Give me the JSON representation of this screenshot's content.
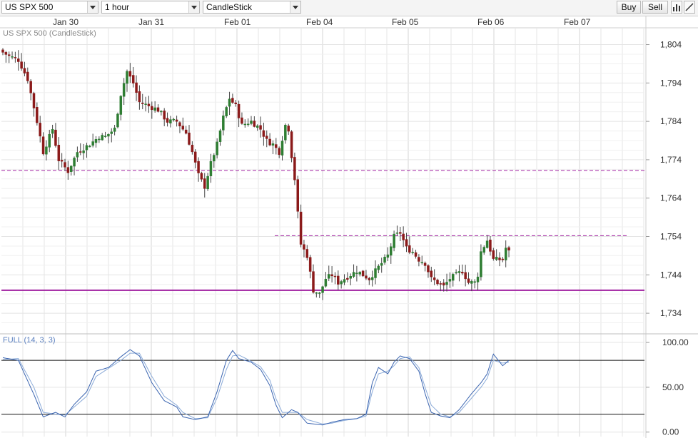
{
  "toolbar": {
    "symbol": "US SPX 500",
    "interval": "1 hour",
    "chart_type": "CandleStick",
    "buy_label": "Buy",
    "sell_label": "Sell",
    "icons": [
      "bar-chart-icon",
      "draw-line-icon"
    ]
  },
  "colors": {
    "bull": "#2e7d32",
    "bear": "#8b1a1a",
    "support_line": "#a020a0",
    "resistance_line": "#a020a0",
    "stoch_k": "#3a64b0",
    "stoch_d": "#8aaad8",
    "grid": "#e4e4e4"
  },
  "chart_data": [
    {
      "type": "candlestick",
      "title": "US SPX 500 (CandleStick)",
      "x_tick_labels": [
        "Jan 30",
        "Jan 31",
        "Feb 01",
        "Feb 04",
        "Feb 05",
        "Feb 06",
        "Feb 07"
      ],
      "y_ticks": [
        "1,804",
        "1,794",
        "1,784",
        "1,774",
        "1,764",
        "1,754",
        "1,744",
        "1,734"
      ],
      "ylim": [
        1729,
        1808
      ],
      "grid": true,
      "levels": [
        {
          "name": "resistance-upper",
          "value": 1771.2,
          "style": "dashed"
        },
        {
          "name": "resistance-lower",
          "value": 1754.2,
          "style": "dashed"
        },
        {
          "name": "support",
          "value": 1740.0,
          "style": "solid"
        }
      ],
      "anchors": [
        {
          "i": 0,
          "v": 1802
        },
        {
          "i": 2,
          "v": 1801
        },
        {
          "i": 5,
          "v": 1800
        },
        {
          "i": 8,
          "v": 1795
        },
        {
          "i": 11,
          "v": 1784
        },
        {
          "i": 13,
          "v": 1776
        },
        {
          "i": 16,
          "v": 1782
        },
        {
          "i": 18,
          "v": 1774
        },
        {
          "i": 21,
          "v": 1771
        },
        {
          "i": 24,
          "v": 1776
        },
        {
          "i": 28,
          "v": 1778
        },
        {
          "i": 31,
          "v": 1780
        },
        {
          "i": 33,
          "v": 1780
        },
        {
          "i": 36,
          "v": 1782
        },
        {
          "i": 38,
          "v": 1791
        },
        {
          "i": 40,
          "v": 1797
        },
        {
          "i": 42,
          "v": 1794
        },
        {
          "i": 44,
          "v": 1789
        },
        {
          "i": 47,
          "v": 1788
        },
        {
          "i": 50,
          "v": 1787
        },
        {
          "i": 53,
          "v": 1784
        },
        {
          "i": 56,
          "v": 1784
        },
        {
          "i": 59,
          "v": 1781
        },
        {
          "i": 61,
          "v": 1776
        },
        {
          "i": 63,
          "v": 1770
        },
        {
          "i": 65,
          "v": 1767
        },
        {
          "i": 67,
          "v": 1773
        },
        {
          "i": 69,
          "v": 1778
        },
        {
          "i": 71,
          "v": 1785
        },
        {
          "i": 73,
          "v": 1790
        },
        {
          "i": 75,
          "v": 1788
        },
        {
          "i": 77,
          "v": 1783
        },
        {
          "i": 80,
          "v": 1784
        },
        {
          "i": 83,
          "v": 1782
        },
        {
          "i": 85,
          "v": 1779
        },
        {
          "i": 87,
          "v": 1778
        },
        {
          "i": 89,
          "v": 1776
        },
        {
          "i": 91,
          "v": 1783
        },
        {
          "i": 92,
          "v": 1782
        },
        {
          "i": 93,
          "v": 1775
        },
        {
          "i": 94,
          "v": 1769
        },
        {
          "i": 95,
          "v": 1760
        },
        {
          "i": 96,
          "v": 1752
        },
        {
          "i": 98,
          "v": 1749
        },
        {
          "i": 100,
          "v": 1740
        },
        {
          "i": 102,
          "v": 1739
        },
        {
          "i": 104,
          "v": 1743
        },
        {
          "i": 106,
          "v": 1744
        },
        {
          "i": 108,
          "v": 1742
        },
        {
          "i": 110,
          "v": 1743
        },
        {
          "i": 112,
          "v": 1744
        },
        {
          "i": 114,
          "v": 1745
        },
        {
          "i": 116,
          "v": 1744
        },
        {
          "i": 118,
          "v": 1743
        },
        {
          "i": 120,
          "v": 1745
        },
        {
          "i": 122,
          "v": 1747
        },
        {
          "i": 124,
          "v": 1749
        },
        {
          "i": 126,
          "v": 1754
        },
        {
          "i": 128,
          "v": 1755
        },
        {
          "i": 130,
          "v": 1751
        },
        {
          "i": 132,
          "v": 1750
        },
        {
          "i": 134,
          "v": 1748
        },
        {
          "i": 136,
          "v": 1747
        },
        {
          "i": 138,
          "v": 1743
        },
        {
          "i": 140,
          "v": 1742
        },
        {
          "i": 142,
          "v": 1741
        },
        {
          "i": 144,
          "v": 1743
        },
        {
          "i": 146,
          "v": 1744
        },
        {
          "i": 148,
          "v": 1745
        },
        {
          "i": 150,
          "v": 1742
        },
        {
          "i": 152,
          "v": 1742
        },
        {
          "i": 153,
          "v": 1744
        },
        {
          "i": 154,
          "v": 1750
        },
        {
          "i": 156,
          "v": 1753
        },
        {
          "i": 158,
          "v": 1748
        },
        {
          "i": 160,
          "v": 1748
        },
        {
          "i": 161,
          "v": 1748
        },
        {
          "i": 162,
          "v": 1751
        },
        {
          "i": 163,
          "v": 1750
        }
      ],
      "candle_count": 164,
      "last_close": 1750
    },
    {
      "type": "line",
      "title": "FULL (14, 3, 3)",
      "y_ticks": [
        "100.00",
        "50.00",
        "0.00"
      ],
      "ylim": [
        -5,
        108
      ],
      "levels": [
        80,
        20
      ],
      "series": [
        {
          "name": "%K",
          "anchors": [
            [
              0,
              83
            ],
            [
              5,
              80
            ],
            [
              10,
              42
            ],
            [
              13,
              17
            ],
            [
              17,
              22
            ],
            [
              20,
              17
            ],
            [
              23,
              31
            ],
            [
              27,
              45
            ],
            [
              30,
              68
            ],
            [
              34,
              72
            ],
            [
              38,
              84
            ],
            [
              41,
              92
            ],
            [
              44,
              85
            ],
            [
              48,
              55
            ],
            [
              52,
              35
            ],
            [
              56,
              28
            ],
            [
              58,
              17
            ],
            [
              62,
              14
            ],
            [
              66,
              17
            ],
            [
              69,
              45
            ],
            [
              72,
              80
            ],
            [
              74,
              91
            ],
            [
              76,
              82
            ],
            [
              80,
              78
            ],
            [
              83,
              70
            ],
            [
              86,
              52
            ],
            [
              88,
              30
            ],
            [
              90,
              16
            ],
            [
              93,
              25
            ],
            [
              95,
              22
            ],
            [
              98,
              10
            ],
            [
              103,
              8
            ],
            [
              106,
              11
            ],
            [
              110,
              14
            ],
            [
              114,
              15
            ],
            [
              117,
              20
            ],
            [
              119,
              55
            ],
            [
              121,
              72
            ],
            [
              124,
              65
            ],
            [
              126,
              78
            ],
            [
              128,
              85
            ],
            [
              131,
              82
            ],
            [
              134,
              68
            ],
            [
              136,
              43
            ],
            [
              138,
              22
            ],
            [
              141,
              18
            ],
            [
              144,
              16
            ],
            [
              147,
              25
            ],
            [
              151,
              43
            ],
            [
              154,
              55
            ],
            [
              156,
              65
            ],
            [
              158,
              87
            ],
            [
              161,
              74
            ],
            [
              163,
              80
            ]
          ]
        },
        {
          "name": "%D",
          "anchors": [
            [
              0,
              81
            ],
            [
              5,
              82
            ],
            [
              10,
              50
            ],
            [
              13,
              22
            ],
            [
              17,
              20
            ],
            [
              20,
              19
            ],
            [
              23,
              28
            ],
            [
              27,
              40
            ],
            [
              30,
              62
            ],
            [
              34,
              71
            ],
            [
              38,
              80
            ],
            [
              41,
              88
            ],
            [
              44,
              88
            ],
            [
              48,
              62
            ],
            [
              52,
              40
            ],
            [
              56,
              30
            ],
            [
              58,
              22
            ],
            [
              62,
              15
            ],
            [
              66,
              16
            ],
            [
              69,
              38
            ],
            [
              72,
              70
            ],
            [
              74,
              85
            ],
            [
              76,
              86
            ],
            [
              80,
              79
            ],
            [
              83,
              73
            ],
            [
              86,
              58
            ],
            [
              88,
              37
            ],
            [
              90,
              22
            ],
            [
              93,
              22
            ],
            [
              95,
              22
            ],
            [
              98,
              14
            ],
            [
              103,
              9
            ],
            [
              106,
              10
            ],
            [
              110,
              13
            ],
            [
              114,
              15
            ],
            [
              117,
              18
            ],
            [
              119,
              45
            ],
            [
              121,
              65
            ],
            [
              124,
              68
            ],
            [
              126,
              74
            ],
            [
              128,
              82
            ],
            [
              131,
              84
            ],
            [
              134,
              72
            ],
            [
              136,
              50
            ],
            [
              138,
              30
            ],
            [
              141,
              20
            ],
            [
              144,
              17
            ],
            [
              147,
              22
            ],
            [
              151,
              38
            ],
            [
              154,
              50
            ],
            [
              156,
              60
            ],
            [
              158,
              80
            ],
            [
              161,
              77
            ],
            [
              163,
              78
            ]
          ]
        }
      ]
    }
  ]
}
